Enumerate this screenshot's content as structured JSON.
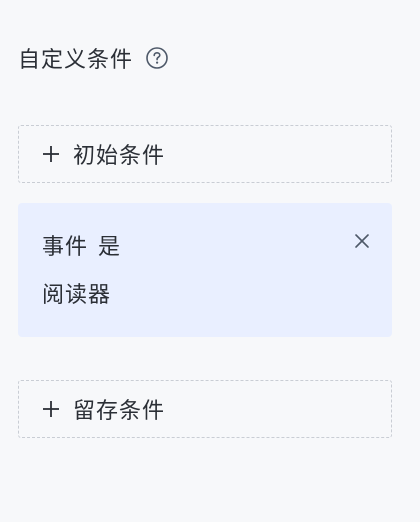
{
  "header": {
    "title": "自定义条件",
    "help_icon": "question-circle-icon"
  },
  "initial_condition": {
    "label": "初始条件",
    "icon": "plus-icon"
  },
  "condition_card": {
    "event_label": "事件",
    "operator": "是",
    "value": "阅读器",
    "close_icon": "close-icon",
    "background": "#e9efff"
  },
  "retain_condition": {
    "label": "留存条件",
    "icon": "plus-icon"
  }
}
